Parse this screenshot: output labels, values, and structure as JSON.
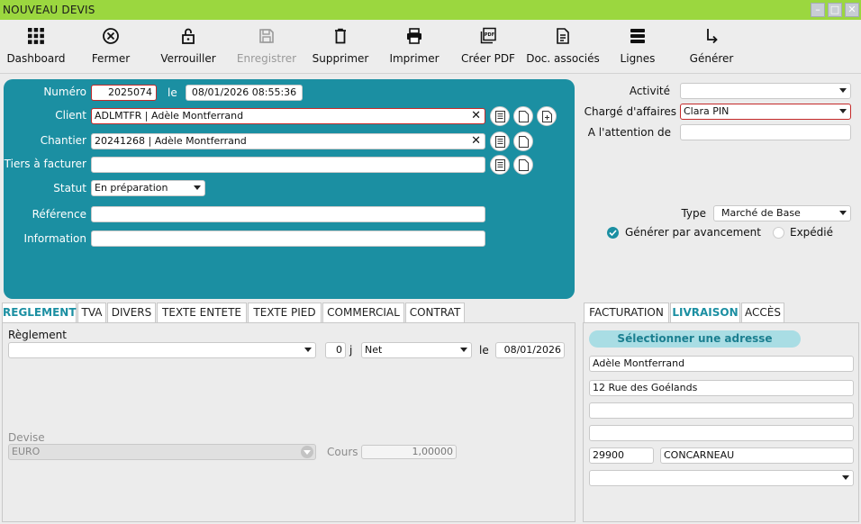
{
  "window": {
    "title": "NOUVEAU DEVIS"
  },
  "toolbar": [
    {
      "name": "dashboard-button",
      "icon": "grid-icon",
      "label": "Dashboard",
      "disabled": false
    },
    {
      "name": "fermer-button",
      "icon": "close-circle-icon",
      "label": "Fermer",
      "disabled": false
    },
    {
      "name": "verrouiller-button",
      "icon": "unlock-icon",
      "label": "Verrouiller",
      "disabled": false
    },
    {
      "name": "enregistrer-button",
      "icon": "save-icon",
      "label": "Enregistrer",
      "disabled": true
    },
    {
      "name": "supprimer-button",
      "icon": "trash-icon",
      "label": "Supprimer",
      "disabled": false
    },
    {
      "name": "imprimer-button",
      "icon": "printer-icon",
      "label": "Imprimer",
      "disabled": false
    },
    {
      "name": "creer-pdf-button",
      "icon": "pdf-icon",
      "label": "Créer PDF",
      "disabled": false
    },
    {
      "name": "doc-associes-button",
      "icon": "document-icon",
      "label": "Doc. associés",
      "disabled": false
    },
    {
      "name": "lignes-button",
      "icon": "lines-icon",
      "label": "Lignes",
      "disabled": false
    },
    {
      "name": "generer-button",
      "icon": "arrow-turn-icon",
      "label": "Générer",
      "disabled": false
    }
  ],
  "header": {
    "numero_label": "Numéro",
    "numero_value": "2025074",
    "le_label": "le",
    "date_value": "08/01/2026 08:55:36",
    "client_label": "Client",
    "client_value": "ADLMTFR | Adèle Montferrand",
    "chantier_label": "Chantier",
    "chantier_value": "20241268 | Adèle Montferrand",
    "tiers_label": "Tiers à facturer",
    "tiers_value": "",
    "statut_label": "Statut",
    "statut_value": "En préparation",
    "reference_label": "Référence",
    "reference_value": "",
    "information_label": "Information",
    "information_value": ""
  },
  "right_form": {
    "activite_label": "Activité",
    "activite_value": "",
    "charge_label": "Chargé d'affaires",
    "charge_value": "Clara PIN",
    "attention_label": "A l'attention de",
    "attention_value": "",
    "type_label": "Type",
    "type_value": "Marché de Base",
    "generer_avancement_label": "Générer par avancement",
    "generer_avancement_checked": true,
    "expedie_label": "Expédié",
    "expedie_checked": false
  },
  "left_tabs": [
    "REGLEMENT",
    "TVA",
    "DIVERS",
    "TEXTE ENTETE",
    "TEXTE PIED",
    "COMMERCIAL",
    "CONTRAT"
  ],
  "reglement": {
    "reglement_label": "Règlement",
    "reglement_value": "",
    "days_value": "0",
    "days_unit": "j",
    "terme_value": "Net",
    "le_label": "le",
    "date_value": "08/01/2026",
    "devise_label": "Devise",
    "devise_value": "EURO",
    "cours_label": "Cours",
    "cours_value": "1,00000"
  },
  "right_tabs": [
    "FACTURATION",
    "LIVRAISON",
    "ACCÈS"
  ],
  "livraison": {
    "select_address_label": "Sélectionner une adresse",
    "name": "Adèle Montferrand",
    "address1": "12 Rue des Goélands",
    "address2": "",
    "address3": "",
    "postal_code": "29900",
    "city": "CONCARNEAU",
    "country": ""
  },
  "colors": {
    "titlebar": "#9bd73f",
    "teal": "#1b8fa2",
    "required_border": "#c42a2a"
  }
}
